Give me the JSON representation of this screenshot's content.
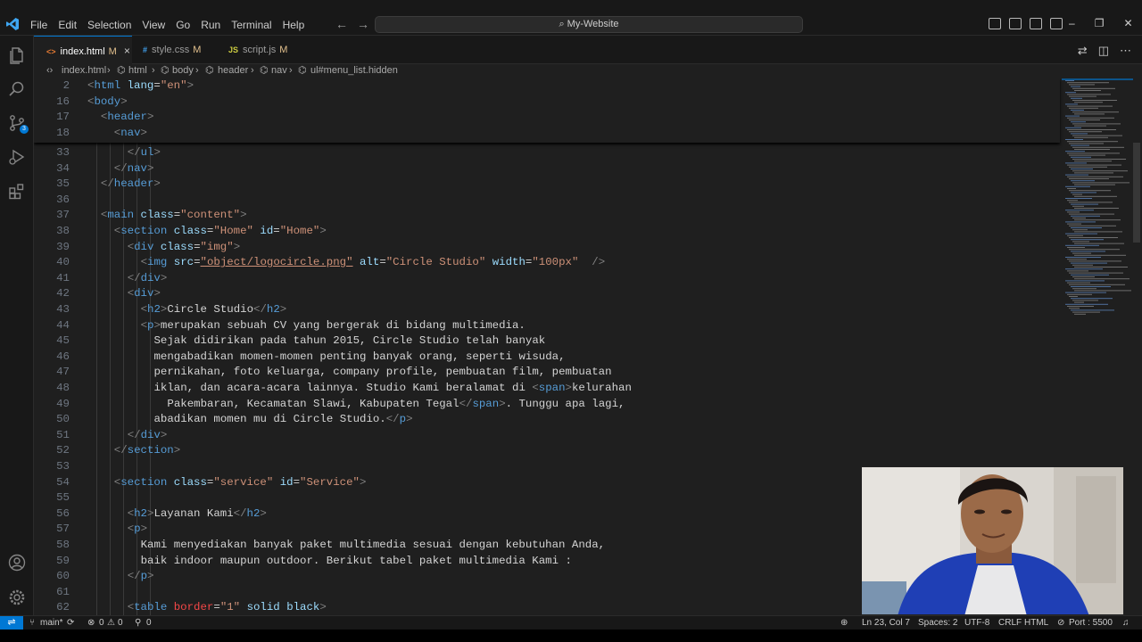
{
  "titlebar": {
    "menu": [
      "File",
      "Edit",
      "Selection",
      "View",
      "Go",
      "Run",
      "Terminal",
      "Help"
    ],
    "search_text": "My-Website"
  },
  "tabs": [
    {
      "icon": "<>",
      "label": "index.html",
      "modified": "M",
      "close": "×"
    },
    {
      "icon": "#",
      "label": "style.css",
      "modified": "M"
    },
    {
      "icon": "JS",
      "label": "script.js",
      "modified": "M"
    }
  ],
  "breadcrumb": [
    "index.html",
    "html",
    "body",
    "header",
    "nav",
    "ul#menu_list.hidden"
  ],
  "activity_badge": "3",
  "sticky_lines": [
    {
      "num": "2",
      "text": "<html lang=\"en\">"
    },
    {
      "num": "16",
      "text": "<body>"
    },
    {
      "num": "17",
      "text": "<header>"
    },
    {
      "num": "18",
      "text": "<nav>"
    }
  ],
  "code_lines": [
    {
      "num": "33",
      "text": "</ul>"
    },
    {
      "num": "34",
      "text": "</nav>"
    },
    {
      "num": "35",
      "text": "</header>"
    },
    {
      "num": "36",
      "text": ""
    },
    {
      "num": "37",
      "text": "<main class=\"content\">"
    },
    {
      "num": "38",
      "text": "<section class=\"Home\" id=\"Home\">"
    },
    {
      "num": "39",
      "text": "<div class=\"img\">"
    },
    {
      "num": "40",
      "text": "<img src=\"object/logocircle.png\" alt=\"Circle Studio\" width=\"100px\" />"
    },
    {
      "num": "41",
      "text": "</div>"
    },
    {
      "num": "42",
      "text": "<div>"
    },
    {
      "num": "43",
      "text": "<h2>Circle Studio</h2>"
    },
    {
      "num": "44",
      "text": "<p>merupakan sebuah CV yang bergerak di bidang multimedia."
    },
    {
      "num": "45",
      "text": "Sejak didirikan pada tahun 2015, Circle Studio telah banyak"
    },
    {
      "num": "46",
      "text": "mengabadikan momen-momen penting banyak orang, seperti wisuda,"
    },
    {
      "num": "47",
      "text": "pernikahan, foto keluarga, company profile, pembuatan film, pembuatan"
    },
    {
      "num": "48",
      "text": "iklan, dan acara-acara lainnya. Studio Kami beralamat di <span>kelurahan"
    },
    {
      "num": "49",
      "text": "Pakembaran, Kecamatan Slawi, Kabupaten Tegal</span>. Tunggu apa lagi,"
    },
    {
      "num": "50",
      "text": "abadikan momen mu di Circle Studio.</p>"
    },
    {
      "num": "51",
      "text": "</div>"
    },
    {
      "num": "52",
      "text": "</section>"
    },
    {
      "num": "53",
      "text": ""
    },
    {
      "num": "54",
      "text": "<section class=\"service\" id=\"Service\">"
    },
    {
      "num": "55",
      "text": ""
    },
    {
      "num": "56",
      "text": "<h2>Layanan Kami</h2>"
    },
    {
      "num": "57",
      "text": "<p>"
    },
    {
      "num": "58",
      "text": "Kami menyediakan banyak paket multimedia sesuai dengan kebutuhan Anda,"
    },
    {
      "num": "59",
      "text": "baik indoor maupun outdoor. Berikut tabel paket multimedia Kami :"
    },
    {
      "num": "60",
      "text": "</p>"
    },
    {
      "num": "61",
      "text": ""
    },
    {
      "num": "62",
      "text": "<table border=\"1\" solid black>"
    }
  ],
  "statusbar": {
    "branch": "main*",
    "errors": "0",
    "warnings": "0",
    "ports": "0",
    "position": "Ln 23, Col 7",
    "spaces": "Spaces: 2",
    "encoding": "UTF-8",
    "eol": "CRLF",
    "language": "HTML",
    "port": "Port : 5500"
  },
  "colors": {
    "accent": "#0078d4",
    "editor_bg": "#1f1f1f",
    "chrome_bg": "#181818",
    "tag": "#569cd6",
    "attr_name": "#9cdcfe",
    "attr_value": "#ce9178",
    "modified": "#e2c08d"
  }
}
